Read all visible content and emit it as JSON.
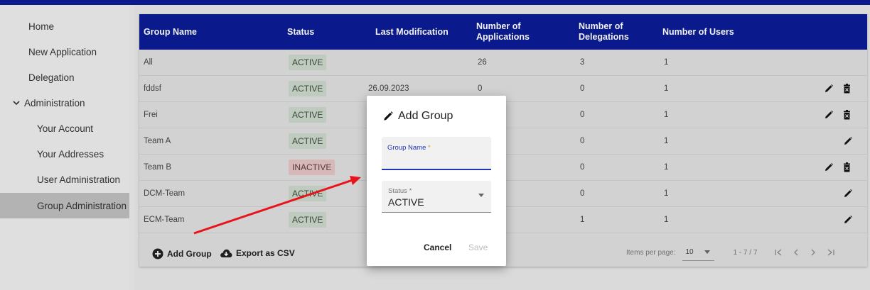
{
  "sidebar": {
    "items": [
      {
        "label": "Home"
      },
      {
        "label": "New Application"
      },
      {
        "label": "Delegation"
      },
      {
        "label": "Administration"
      },
      {
        "label": "Your Account"
      },
      {
        "label": "Your Addresses"
      },
      {
        "label": "User Administration"
      },
      {
        "label": "Group Administration"
      }
    ]
  },
  "table": {
    "headers": {
      "group_name": "Group Name",
      "status": "Status",
      "last_modification": "Last Modification",
      "num_apps": "Number of Applications",
      "num_delegations": "Number of Delegations",
      "num_users": "Number of Users"
    },
    "rows": [
      {
        "name": "All",
        "status": "ACTIVE",
        "modified": "",
        "apps": "26",
        "delegations": "3",
        "users": "1"
      },
      {
        "name": "fddsf",
        "status": "ACTIVE",
        "modified": "26.09.2023",
        "apps": "0",
        "delegations": "0",
        "users": "1"
      },
      {
        "name": "Frei",
        "status": "ACTIVE",
        "modified": "",
        "apps": "",
        "delegations": "0",
        "users": "1"
      },
      {
        "name": "Team A",
        "status": "ACTIVE",
        "modified": "",
        "apps": "",
        "delegations": "0",
        "users": "1"
      },
      {
        "name": "Team B",
        "status": "INACTIVE",
        "modified": "",
        "apps": "",
        "delegations": "0",
        "users": "1"
      },
      {
        "name": "DCM-Team",
        "status": "ACTIVE",
        "modified": "",
        "apps": "",
        "delegations": "0",
        "users": "1"
      },
      {
        "name": "ECM-Team",
        "status": "ACTIVE",
        "modified": "",
        "apps": "",
        "delegations": "1",
        "users": "1"
      }
    ]
  },
  "footer": {
    "add_group": "Add Group",
    "export_csv": "Export as CSV",
    "items_per_page_label": "Items per page:",
    "items_per_page_value": "10",
    "range": "1 - 7 / 7"
  },
  "dialog": {
    "title": "Add Group",
    "group_name_label": "Group Name",
    "required_mark": "*",
    "status_label": "Status *",
    "status_value": "ACTIVE",
    "cancel": "Cancel",
    "save": "Save"
  },
  "colors": {
    "primary": "#0b1c94",
    "annotation_arrow": "#e8131b"
  },
  "icons": [
    "chevron-down-icon",
    "pencil-icon",
    "trash-icon",
    "plus-circle-icon",
    "cloud-download-icon",
    "first-page-icon",
    "prev-page-icon",
    "next-page-icon",
    "last-page-icon"
  ]
}
